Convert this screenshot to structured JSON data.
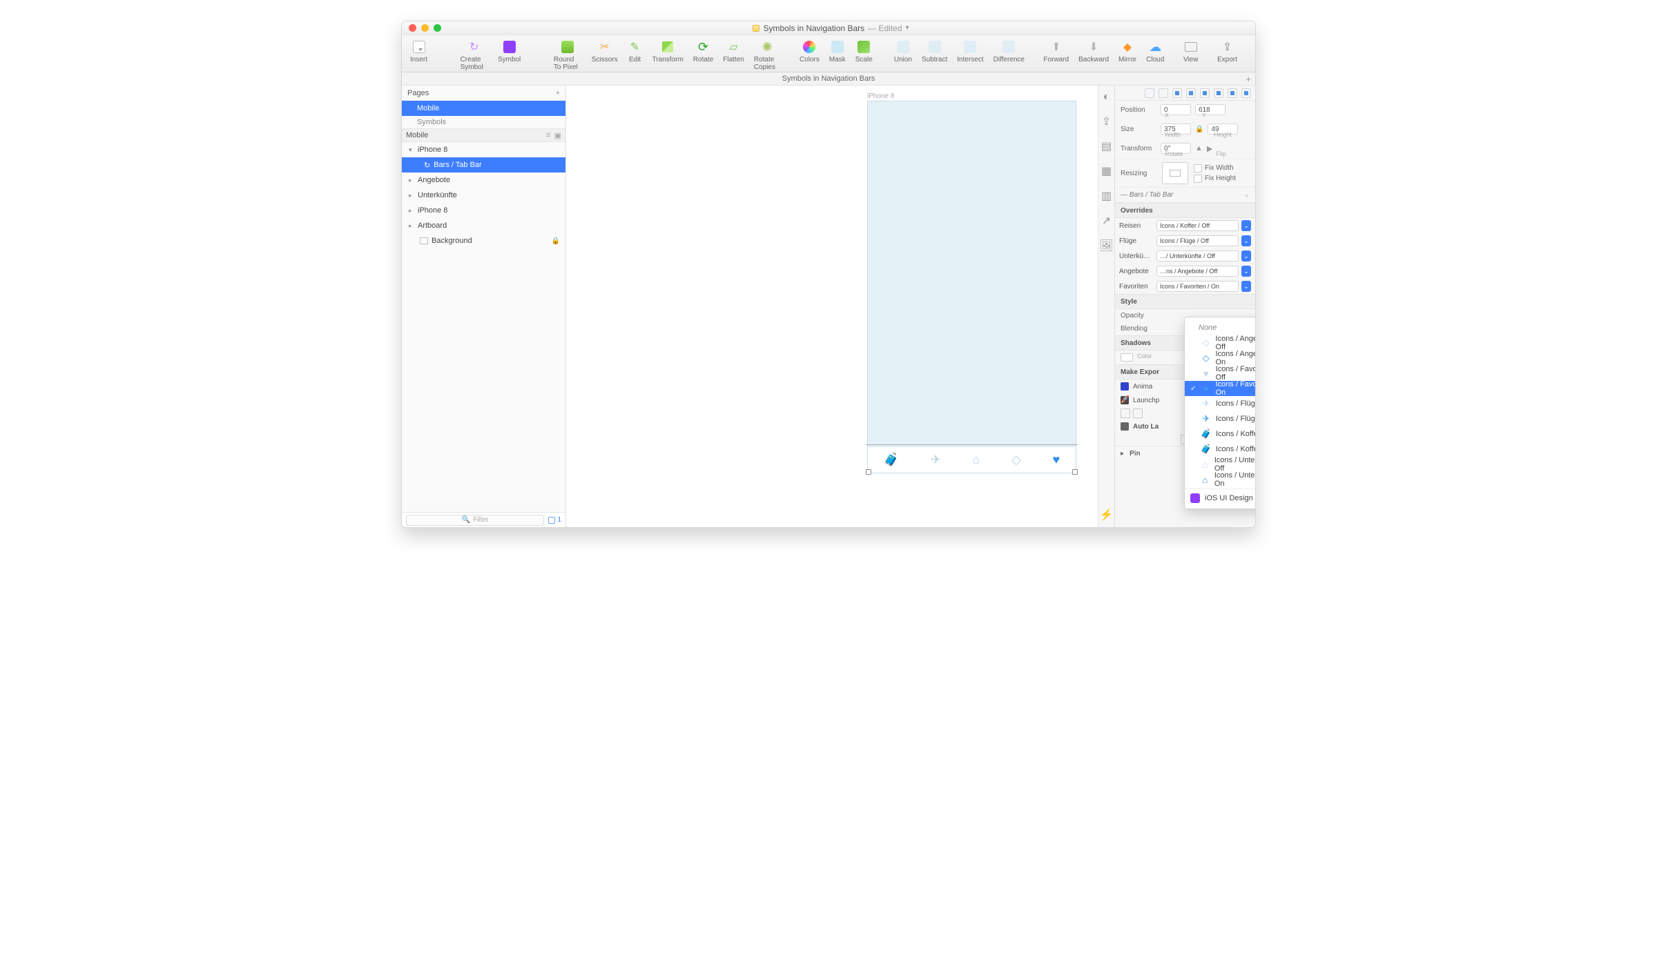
{
  "window": {
    "title": "Symbols in Navigation Bars",
    "edited": "— Edited",
    "subtitle": "Symbols in Navigation Bars"
  },
  "toolbar": {
    "insert": "Insert",
    "create_symbol": "Create Symbol",
    "symbol": "Symbol",
    "round": "Round To Pixel",
    "scissors": "Scissors",
    "edit": "Edit",
    "transform": "Transform",
    "rotate": "Rotate",
    "flatten": "Flatten",
    "rotate_copies": "Rotate Copies",
    "colors": "Colors",
    "mask": "Mask",
    "scale": "Scale",
    "union": "Union",
    "subtract": "Subtract",
    "intersect": "Intersect",
    "difference": "Difference",
    "forward": "Forward",
    "backward": "Backward",
    "mirror": "Mirror",
    "cloud": "Cloud",
    "view": "View",
    "export": "Export"
  },
  "sidebar": {
    "pages_label": "Pages",
    "page_mobile": "Mobile",
    "page_symbols": "Symbols",
    "layer_header": "Mobile",
    "tree": {
      "iphone8": "iPhone 8",
      "bars_tab": "Bars / Tab Bar",
      "angebote": "Angebote",
      "unterkunfte": "Unterkünfte",
      "iphone8b": "iPhone 8",
      "artboard": "Artboard",
      "background": "Background"
    },
    "filter": "Filter",
    "count": "1"
  },
  "canvas": {
    "artboard_label": "iPhone 8"
  },
  "inspector": {
    "position_label": "Position",
    "pos_x": "0",
    "pos_y": "618",
    "x_l": "X",
    "y_l": "Y",
    "size_label": "Size",
    "w": "375",
    "h": "49",
    "w_l": "Width",
    "h_l": "Height",
    "transform_label": "Transform",
    "rot": "0°",
    "rot_l": "Rotate",
    "flip_l": "Flip",
    "resizing": "Resizing",
    "fix_w": "Fix Width",
    "fix_h": "Fix Height",
    "symbol_path": "Bars / Tab Bar",
    "overrides_h": "Overrides",
    "ovr": [
      {
        "label": "Reisen",
        "value": "Icons / Koffer / Off"
      },
      {
        "label": "Flüge",
        "value": "Icons / Flüge / Off"
      },
      {
        "label": "Unterkün…",
        "value": "…/ Unterkünfte / Off"
      },
      {
        "label": "Angebote",
        "value": "…ns / Angebote / Off"
      },
      {
        "label": "Favoriten",
        "value": "Icons / Favoriten / On"
      }
    ],
    "style_h": "Style",
    "opacity": "Opacity",
    "blending": "Blending",
    "shadows_h": "Shadows",
    "color": "Color",
    "make_export": "Make Expor",
    "anima": "Anima",
    "launchpad": "Launchp",
    "autolayout": "Auto La",
    "pin": "Pin"
  },
  "dropdown": {
    "none": "None",
    "items": [
      {
        "label": "Icons / Angebote / Off",
        "state": "off",
        "glyph": "tag"
      },
      {
        "label": "Icons / Angebote / On",
        "state": "on",
        "glyph": "tag"
      },
      {
        "label": "Icons / Favoriten / Off",
        "state": "off",
        "glyph": "heart"
      },
      {
        "label": "Icons / Favoriten / On",
        "state": "on",
        "glyph": "heart",
        "selected": true
      },
      {
        "label": "Icons / Flüge / Off",
        "state": "off",
        "glyph": "plane"
      },
      {
        "label": "Icons / Flüge / On",
        "state": "on",
        "glyph": "plane"
      },
      {
        "label": "Icons / Koffer / Off",
        "state": "off",
        "glyph": "case"
      },
      {
        "label": "Icons / Koffer / On",
        "state": "on",
        "glyph": "case"
      },
      {
        "label": "Icons / Unterkünfte / Off",
        "state": "off",
        "glyph": "home"
      },
      {
        "label": "Icons / Unterkünfte / On",
        "state": "on",
        "glyph": "home"
      }
    ],
    "ios": "iOS UI Design"
  }
}
